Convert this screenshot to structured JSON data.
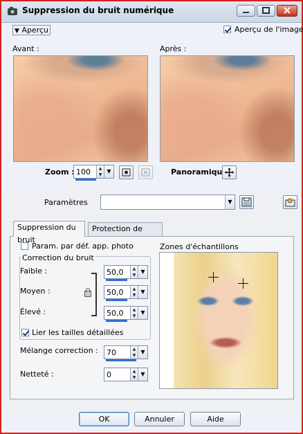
{
  "window": {
    "title": "Suppression du bruit numérique"
  },
  "top": {
    "apercu_label": "Aperçu",
    "apercu_image_label": "Aperçu de l'image",
    "avant_label": "Avant :",
    "apres_label": "Après :",
    "zoom_label": "Zoom :",
    "zoom_value": "100",
    "panoramique_label": "Panoramique :"
  },
  "params": {
    "label": "Paramètres",
    "value": ""
  },
  "tabs": [
    {
      "label": "Suppression du bruit"
    },
    {
      "label": "Protection de l'image"
    }
  ],
  "panel": {
    "param_photo_label": "Param. par déf. app. photo",
    "correction_group_label": "Correction du bruit",
    "faible_label": "Faible :",
    "faible_value": "50,0",
    "moyen_label": "Moyen :",
    "moyen_value": "50,0",
    "eleve_label": "Élevé :",
    "eleve_value": "50,0",
    "lier_label": "Lier les tailles détaillées",
    "melange_label": "Mélange correction :",
    "melange_value": "70",
    "nettete_label": "Netteté :",
    "nettete_value": "0",
    "zones_label": "Zones d'échantillons"
  },
  "buttons": {
    "ok": "OK",
    "annuler": "Annuler",
    "aide": "Aide"
  },
  "colors": {
    "window_border": "#d42020",
    "spin_bar": "#2f6fd6",
    "title_bg": "#cbd7e6"
  }
}
